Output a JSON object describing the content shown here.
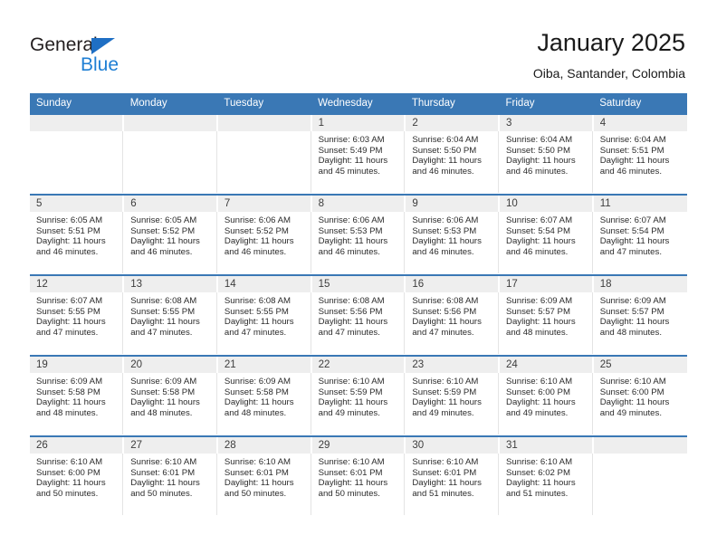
{
  "brand": {
    "name_part1": "General",
    "name_part2": "Blue",
    "accent_color": "#1f7fd4",
    "triangle_color": "#1f6fc4"
  },
  "header": {
    "title": "January 2025",
    "location": "Oiba, Santander, Colombia"
  },
  "theme": {
    "header_bg": "#3a78b5",
    "daynum_bg": "#eeeeee",
    "text_color": "#2b2b2b"
  },
  "weekdays": [
    "Sunday",
    "Monday",
    "Tuesday",
    "Wednesday",
    "Thursday",
    "Friday",
    "Saturday"
  ],
  "weeks": [
    [
      {
        "day": "",
        "sunrise": "",
        "sunset": "",
        "daylight1": "",
        "daylight2": "",
        "empty": true
      },
      {
        "day": "",
        "sunrise": "",
        "sunset": "",
        "daylight1": "",
        "daylight2": "",
        "empty": true
      },
      {
        "day": "",
        "sunrise": "",
        "sunset": "",
        "daylight1": "",
        "daylight2": "",
        "empty": true
      },
      {
        "day": "1",
        "sunrise": "Sunrise: 6:03 AM",
        "sunset": "Sunset: 5:49 PM",
        "daylight1": "Daylight: 11 hours",
        "daylight2": "and 45 minutes."
      },
      {
        "day": "2",
        "sunrise": "Sunrise: 6:04 AM",
        "sunset": "Sunset: 5:50 PM",
        "daylight1": "Daylight: 11 hours",
        "daylight2": "and 46 minutes."
      },
      {
        "day": "3",
        "sunrise": "Sunrise: 6:04 AM",
        "sunset": "Sunset: 5:50 PM",
        "daylight1": "Daylight: 11 hours",
        "daylight2": "and 46 minutes."
      },
      {
        "day": "4",
        "sunrise": "Sunrise: 6:04 AM",
        "sunset": "Sunset: 5:51 PM",
        "daylight1": "Daylight: 11 hours",
        "daylight2": "and 46 minutes."
      }
    ],
    [
      {
        "day": "5",
        "sunrise": "Sunrise: 6:05 AM",
        "sunset": "Sunset: 5:51 PM",
        "daylight1": "Daylight: 11 hours",
        "daylight2": "and 46 minutes."
      },
      {
        "day": "6",
        "sunrise": "Sunrise: 6:05 AM",
        "sunset": "Sunset: 5:52 PM",
        "daylight1": "Daylight: 11 hours",
        "daylight2": "and 46 minutes."
      },
      {
        "day": "7",
        "sunrise": "Sunrise: 6:06 AM",
        "sunset": "Sunset: 5:52 PM",
        "daylight1": "Daylight: 11 hours",
        "daylight2": "and 46 minutes."
      },
      {
        "day": "8",
        "sunrise": "Sunrise: 6:06 AM",
        "sunset": "Sunset: 5:53 PM",
        "daylight1": "Daylight: 11 hours",
        "daylight2": "and 46 minutes."
      },
      {
        "day": "9",
        "sunrise": "Sunrise: 6:06 AM",
        "sunset": "Sunset: 5:53 PM",
        "daylight1": "Daylight: 11 hours",
        "daylight2": "and 46 minutes."
      },
      {
        "day": "10",
        "sunrise": "Sunrise: 6:07 AM",
        "sunset": "Sunset: 5:54 PM",
        "daylight1": "Daylight: 11 hours",
        "daylight2": "and 46 minutes."
      },
      {
        "day": "11",
        "sunrise": "Sunrise: 6:07 AM",
        "sunset": "Sunset: 5:54 PM",
        "daylight1": "Daylight: 11 hours",
        "daylight2": "and 47 minutes."
      }
    ],
    [
      {
        "day": "12",
        "sunrise": "Sunrise: 6:07 AM",
        "sunset": "Sunset: 5:55 PM",
        "daylight1": "Daylight: 11 hours",
        "daylight2": "and 47 minutes."
      },
      {
        "day": "13",
        "sunrise": "Sunrise: 6:08 AM",
        "sunset": "Sunset: 5:55 PM",
        "daylight1": "Daylight: 11 hours",
        "daylight2": "and 47 minutes."
      },
      {
        "day": "14",
        "sunrise": "Sunrise: 6:08 AM",
        "sunset": "Sunset: 5:55 PM",
        "daylight1": "Daylight: 11 hours",
        "daylight2": "and 47 minutes."
      },
      {
        "day": "15",
        "sunrise": "Sunrise: 6:08 AM",
        "sunset": "Sunset: 5:56 PM",
        "daylight1": "Daylight: 11 hours",
        "daylight2": "and 47 minutes."
      },
      {
        "day": "16",
        "sunrise": "Sunrise: 6:08 AM",
        "sunset": "Sunset: 5:56 PM",
        "daylight1": "Daylight: 11 hours",
        "daylight2": "and 47 minutes."
      },
      {
        "day": "17",
        "sunrise": "Sunrise: 6:09 AM",
        "sunset": "Sunset: 5:57 PM",
        "daylight1": "Daylight: 11 hours",
        "daylight2": "and 48 minutes."
      },
      {
        "day": "18",
        "sunrise": "Sunrise: 6:09 AM",
        "sunset": "Sunset: 5:57 PM",
        "daylight1": "Daylight: 11 hours",
        "daylight2": "and 48 minutes."
      }
    ],
    [
      {
        "day": "19",
        "sunrise": "Sunrise: 6:09 AM",
        "sunset": "Sunset: 5:58 PM",
        "daylight1": "Daylight: 11 hours",
        "daylight2": "and 48 minutes."
      },
      {
        "day": "20",
        "sunrise": "Sunrise: 6:09 AM",
        "sunset": "Sunset: 5:58 PM",
        "daylight1": "Daylight: 11 hours",
        "daylight2": "and 48 minutes."
      },
      {
        "day": "21",
        "sunrise": "Sunrise: 6:09 AM",
        "sunset": "Sunset: 5:58 PM",
        "daylight1": "Daylight: 11 hours",
        "daylight2": "and 48 minutes."
      },
      {
        "day": "22",
        "sunrise": "Sunrise: 6:10 AM",
        "sunset": "Sunset: 5:59 PM",
        "daylight1": "Daylight: 11 hours",
        "daylight2": "and 49 minutes."
      },
      {
        "day": "23",
        "sunrise": "Sunrise: 6:10 AM",
        "sunset": "Sunset: 5:59 PM",
        "daylight1": "Daylight: 11 hours",
        "daylight2": "and 49 minutes."
      },
      {
        "day": "24",
        "sunrise": "Sunrise: 6:10 AM",
        "sunset": "Sunset: 6:00 PM",
        "daylight1": "Daylight: 11 hours",
        "daylight2": "and 49 minutes."
      },
      {
        "day": "25",
        "sunrise": "Sunrise: 6:10 AM",
        "sunset": "Sunset: 6:00 PM",
        "daylight1": "Daylight: 11 hours",
        "daylight2": "and 49 minutes."
      }
    ],
    [
      {
        "day": "26",
        "sunrise": "Sunrise: 6:10 AM",
        "sunset": "Sunset: 6:00 PM",
        "daylight1": "Daylight: 11 hours",
        "daylight2": "and 50 minutes."
      },
      {
        "day": "27",
        "sunrise": "Sunrise: 6:10 AM",
        "sunset": "Sunset: 6:01 PM",
        "daylight1": "Daylight: 11 hours",
        "daylight2": "and 50 minutes."
      },
      {
        "day": "28",
        "sunrise": "Sunrise: 6:10 AM",
        "sunset": "Sunset: 6:01 PM",
        "daylight1": "Daylight: 11 hours",
        "daylight2": "and 50 minutes."
      },
      {
        "day": "29",
        "sunrise": "Sunrise: 6:10 AM",
        "sunset": "Sunset: 6:01 PM",
        "daylight1": "Daylight: 11 hours",
        "daylight2": "and 50 minutes."
      },
      {
        "day": "30",
        "sunrise": "Sunrise: 6:10 AM",
        "sunset": "Sunset: 6:01 PM",
        "daylight1": "Daylight: 11 hours",
        "daylight2": "and 51 minutes."
      },
      {
        "day": "31",
        "sunrise": "Sunrise: 6:10 AM",
        "sunset": "Sunset: 6:02 PM",
        "daylight1": "Daylight: 11 hours",
        "daylight2": "and 51 minutes."
      },
      {
        "day": "",
        "sunrise": "",
        "sunset": "",
        "daylight1": "",
        "daylight2": "",
        "empty": true
      }
    ]
  ]
}
